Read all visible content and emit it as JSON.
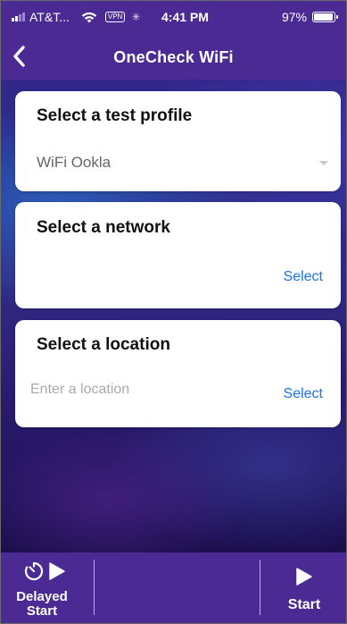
{
  "status_bar": {
    "carrier": "AT&T...",
    "vpn": "VPN",
    "time": "4:41 PM",
    "battery": "97%",
    "battery_level": 0.97,
    "icons": [
      "signal-icon",
      "wifi-icon",
      "vpn-badge",
      "activity-icon",
      "battery-icon"
    ]
  },
  "nav": {
    "title": "OneCheck WiFi",
    "back_icon": "chevron-left-icon"
  },
  "test_profile": {
    "title": "Select a test profile",
    "value": "WiFi Ookla"
  },
  "network": {
    "title": "Select a network",
    "select_label": "Select"
  },
  "location": {
    "title": "Select a location",
    "value": "",
    "placeholder": "Enter a location",
    "select_label": "Select"
  },
  "toolbar": {
    "delayed_start_line1": "Delayed",
    "delayed_start_line2": "Start",
    "start_label": "Start",
    "icons": [
      "timer-icon",
      "play-icon"
    ]
  },
  "colors": {
    "accent": "#4b2a93",
    "link": "#1a73e8",
    "card_bg": "#ffffff"
  }
}
